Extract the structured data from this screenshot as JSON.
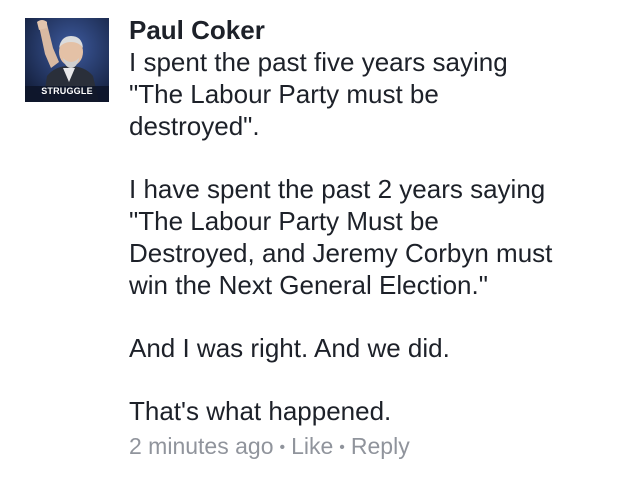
{
  "comment": {
    "author": "Paul Coker",
    "avatar_caption": "STRUGGLE",
    "paragraphs": [
      "I spent the past five years saying\n\"The Labour Party must be\ndestroyed\".",
      "I have spent the past 2 years saying\n\"The Labour Party Must be\nDestroyed, and Jeremy Corbyn must\nwin the Next General Election.\"",
      "And I was right. And we did.",
      "That's what happened."
    ],
    "timestamp": "2 minutes ago",
    "separator": "•",
    "like_label": "Like",
    "reply_label": "Reply"
  },
  "colors": {
    "text": "#1d2129",
    "meta": "#90949c",
    "avatar_bg": "#1c2a4a"
  }
}
